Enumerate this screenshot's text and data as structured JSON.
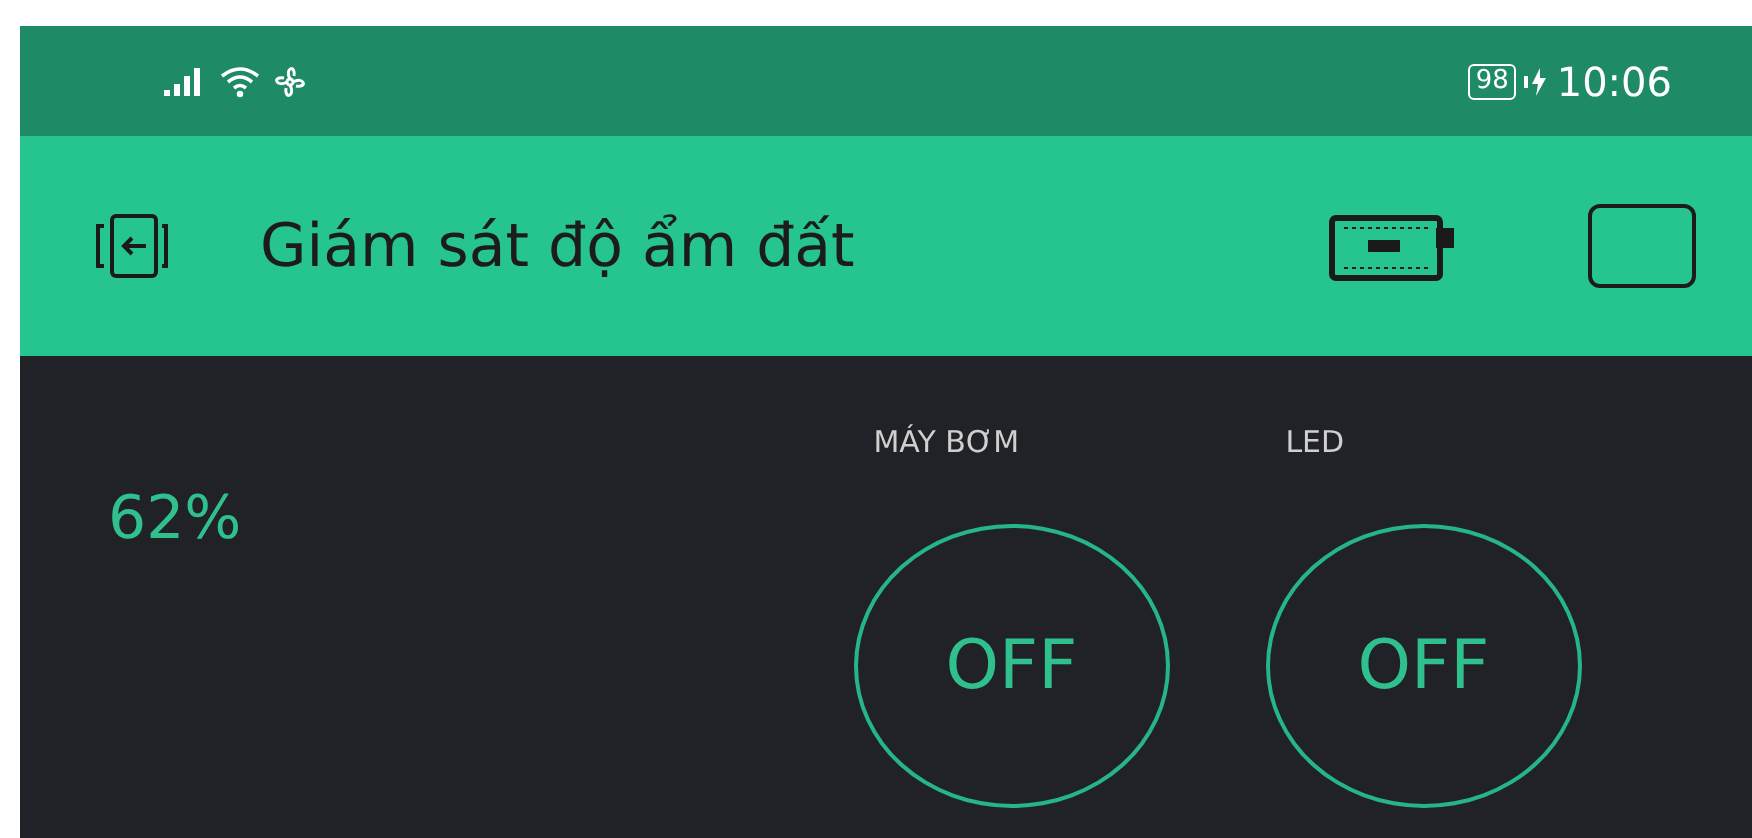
{
  "status_bar": {
    "battery": "98",
    "time": "10:06"
  },
  "header": {
    "title": "Giám sát độ ẩm đất"
  },
  "gauge": {
    "value": "62%"
  },
  "buttons": [
    {
      "label": "MÁY BƠM",
      "text": "OFF",
      "on": false
    },
    {
      "label": "LED",
      "text": "OFF",
      "on": false
    }
  ]
}
